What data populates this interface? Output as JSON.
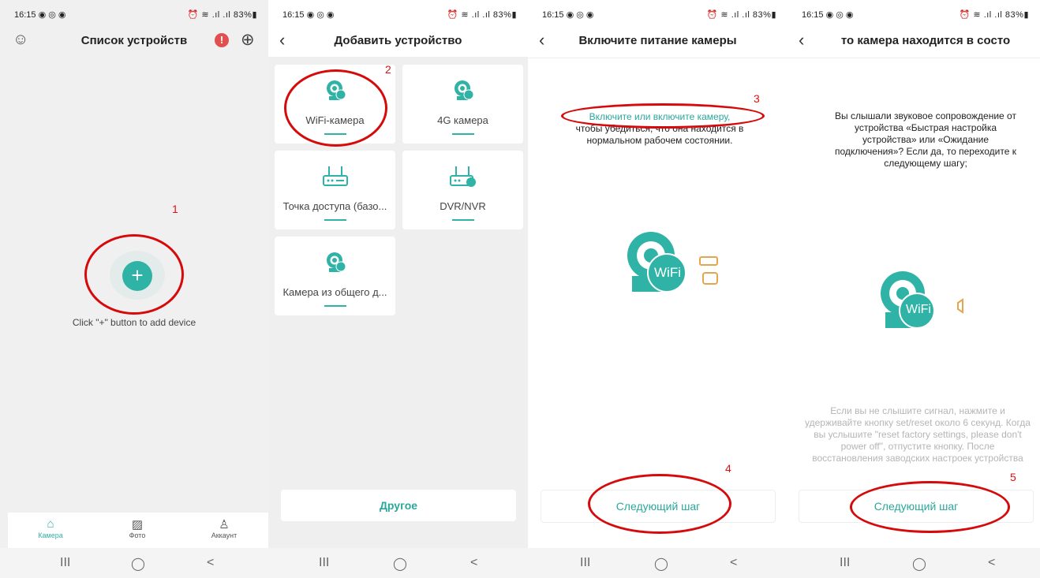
{
  "statusbar": {
    "time": "16:15 ◉ ◎ ◉",
    "right": "⏰ ≋ .ıl .ıl 83%▮"
  },
  "panel1": {
    "title": "Список устройств",
    "add_hint": "Click \"+\" button to add device",
    "add_symbol": "+",
    "annotation": "1",
    "tabs": [
      {
        "label": "Камера",
        "icon": "⌂"
      },
      {
        "label": "Фото",
        "icon": "▨"
      },
      {
        "label": "Аккаунт",
        "icon": "♙"
      }
    ],
    "header_left_icon": "☺",
    "alert_icon": "!",
    "add_icon": "⊕"
  },
  "panel2": {
    "title": "Добавить устройство",
    "annotation": "2",
    "cards": [
      {
        "label": "WiFi-камера",
        "badge": "WiFi"
      },
      {
        "label": "4G камера",
        "badge": "4G"
      },
      {
        "label": "Точка доступа (базо..."
      },
      {
        "label": "DVR/NVR"
      },
      {
        "label": "Камера из общего д..."
      }
    ],
    "other_button": "Другое"
  },
  "panel3": {
    "title": "Включите питание камеры",
    "msg_teal": "Включите или включите камеру,",
    "msg_rest": "чтобы убедиться, что она находится в нормальном рабочем состоянии.",
    "wifi_label": "WiFi",
    "next_button": "Следующий шаг",
    "annotation_top": "3",
    "annotation_bottom": "4"
  },
  "panel4": {
    "title": "то камера находится в состо",
    "msg": "Вы слышали звуковое сопровождение от устройства «Быстрая настройка устройства» или «Ожидание подключения»? Если да, то переходите к следующему шагу;",
    "wifi_label": "WiFi",
    "gray_text": "Если вы не слышите сигнал, нажмите и удерживайте кнопку set/reset около 6 секунд. Когда вы услышите \"reset factory settings, please don't power off\", отпустите кнопку. После восстановления заводских настроек устройства",
    "next_button": "Следующий шаг",
    "annotation": "5"
  },
  "sysnav": {
    "recent": "III",
    "home": "◯",
    "back": "<"
  },
  "colors": {
    "accent": "#2fb3a6",
    "annotation": "#d60a0a"
  }
}
